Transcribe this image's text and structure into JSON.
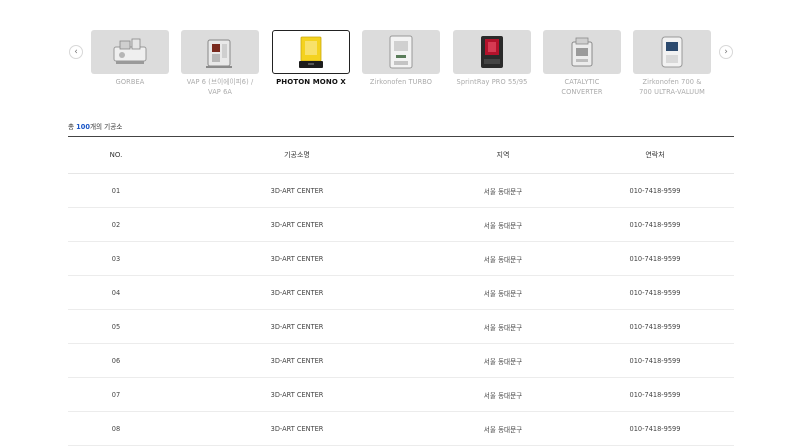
{
  "carousel": {
    "prev_icon": "chevron-left-icon",
    "next_icon": "chevron-right-icon",
    "prev_glyph": "‹",
    "next_glyph": "›",
    "products": [
      {
        "name": "GORBEA",
        "active": false,
        "icon": "casting-machine-icon"
      },
      {
        "name": "VAP 6 (브이에이피6) /\nVAP 6A",
        "active": false,
        "icon": "vacuum-mixer-icon"
      },
      {
        "name": "PHOTON MONO X",
        "active": true,
        "icon": "resin-printer-icon"
      },
      {
        "name": "Zirkonofen TURBO",
        "active": false,
        "icon": "sintering-furnace-icon"
      },
      {
        "name": "SprintRay PRO 55/95",
        "active": false,
        "icon": "dental-printer-icon"
      },
      {
        "name": "CATALYTIC\nCONVERTER",
        "active": false,
        "icon": "converter-icon"
      },
      {
        "name": "Zirkonofen 700 &\n700 ULTRA-VALUUM",
        "active": false,
        "icon": "furnace-icon"
      }
    ]
  },
  "summary": {
    "prefix": "총 ",
    "count": "100",
    "suffix": "개의 기공소"
  },
  "table": {
    "headers": [
      "NO.",
      "기공소명",
      "지역",
      "연락처"
    ],
    "rows": [
      [
        "01",
        "3D-ART CENTER",
        "서울 동대문구",
        "010-7418-9599"
      ],
      [
        "02",
        "3D-ART CENTER",
        "서울 동대문구",
        "010-7418-9599"
      ],
      [
        "03",
        "3D-ART CENTER",
        "서울 동대문구",
        "010-7418-9599"
      ],
      [
        "04",
        "3D-ART CENTER",
        "서울 동대문구",
        "010-7418-9599"
      ],
      [
        "05",
        "3D-ART CENTER",
        "서울 동대문구",
        "010-7418-9599"
      ],
      [
        "06",
        "3D-ART CENTER",
        "서울 동대문구",
        "010-7418-9599"
      ],
      [
        "07",
        "3D-ART CENTER",
        "서울 동대문구",
        "010-7418-9599"
      ],
      [
        "08",
        "3D-ART CENTER",
        "서울 동대문구",
        "010-7418-9599"
      ]
    ]
  },
  "colors": {
    "accent": "#1a56c7",
    "thumb_bg": "#dcdcdc",
    "printer_yellow": "#f4d21f",
    "printer_red": "#b3122b"
  }
}
